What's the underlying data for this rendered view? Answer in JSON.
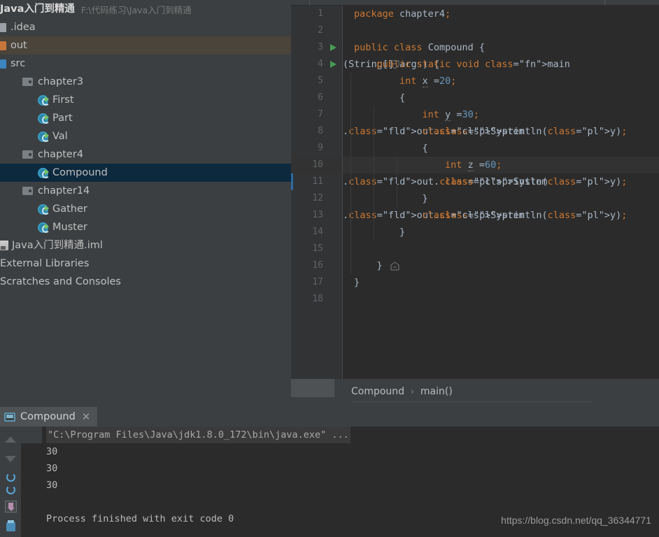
{
  "project": {
    "root": {
      "name": "Java入门到精通",
      "path": "F:\\代码练习\\Java入门到精通",
      "icon": "module-icon"
    },
    "items": [
      {
        "label": ".idea",
        "icon": "module-gray-icon",
        "indent": 0,
        "state": "normal"
      },
      {
        "label": "out",
        "icon": "module-orange-icon",
        "indent": 0,
        "state": "hover"
      },
      {
        "label": "src",
        "icon": "module-blue-icon",
        "indent": 0,
        "state": "normal"
      },
      {
        "label": "chapter3",
        "icon": "folder-icon",
        "indent": 1,
        "state": "normal"
      },
      {
        "label": "First",
        "icon": "java-class-icon",
        "indent": 2,
        "state": "normal"
      },
      {
        "label": "Part",
        "icon": "java-class-icon",
        "indent": 2,
        "state": "normal"
      },
      {
        "label": "Val",
        "icon": "java-class-icon",
        "indent": 2,
        "state": "normal"
      },
      {
        "label": "chapter4",
        "icon": "folder-icon",
        "indent": 1,
        "state": "normal"
      },
      {
        "label": "Compound",
        "icon": "java-class-icon",
        "indent": 2,
        "state": "selected"
      },
      {
        "label": "chapter14",
        "icon": "folder-icon",
        "indent": 1,
        "state": "normal"
      },
      {
        "label": "Gather",
        "icon": "java-class-icon",
        "indent": 2,
        "state": "normal"
      },
      {
        "label": "Muster",
        "icon": "java-class-icon",
        "indent": 2,
        "state": "normal"
      },
      {
        "label": "Java入门到精通.iml",
        "icon": "iml-file-icon",
        "indent": 0,
        "state": "normal"
      },
      {
        "label": "External Libraries",
        "icon": "library-icon",
        "indent": -1,
        "state": "normal"
      },
      {
        "label": "Scratches and Consoles",
        "icon": "scratches-icon",
        "indent": -1,
        "state": "normal"
      }
    ]
  },
  "editor": {
    "caret_line": 10,
    "lines": [
      {
        "n": 1,
        "text": "package chapter4;"
      },
      {
        "n": 2,
        "text": ""
      },
      {
        "n": 3,
        "text": "public class Compound {",
        "run_marker": true
      },
      {
        "n": 4,
        "text": "    public static void main(String[] args) {",
        "run_marker": true,
        "fold": "collapse"
      },
      {
        "n": 5,
        "text": "        int x =20;"
      },
      {
        "n": 6,
        "text": "        {"
      },
      {
        "n": 7,
        "text": "            int y =30;"
      },
      {
        "n": 8,
        "text": "            System.out.println(y);"
      },
      {
        "n": 9,
        "text": "            {"
      },
      {
        "n": 10,
        "text": "                int z =60;"
      },
      {
        "n": 11,
        "text": "                System.out.println(y);"
      },
      {
        "n": 12,
        "text": "            }"
      },
      {
        "n": 13,
        "text": "            System.out.println(y);"
      },
      {
        "n": 14,
        "text": "        }"
      },
      {
        "n": 15,
        "text": ""
      },
      {
        "n": 16,
        "text": "    }",
        "fold": "end"
      },
      {
        "n": 17,
        "text": "}"
      },
      {
        "n": 18,
        "text": ""
      }
    ]
  },
  "breadcrumb": {
    "class": "Compound",
    "separator": "›",
    "method": "main()"
  },
  "run": {
    "tab_label": "Compound",
    "close_label": "✕",
    "toolbar": [
      {
        "icon": "scroll-up-icon"
      },
      {
        "icon": "scroll-down-icon"
      },
      {
        "icon": "rerun-icon"
      },
      {
        "icon": "rerun-failed-icon"
      },
      {
        "icon": "soft-wrap-icon"
      },
      {
        "icon": "print-icon"
      }
    ],
    "console_lines": [
      {
        "text": "\"C:\\Program Files\\Java\\jdk1.8.0_172\\bin\\java.exe\" ...",
        "kind": "command"
      },
      {
        "text": "30",
        "kind": "output"
      },
      {
        "text": "30",
        "kind": "output"
      },
      {
        "text": "30",
        "kind": "output"
      },
      {
        "text": "",
        "kind": "output"
      },
      {
        "text": "Process finished with exit code 0",
        "kind": "output"
      }
    ]
  },
  "watermark": "https://blog.csdn.net/qq_36344771",
  "colors": {
    "editor_bg": "#2b2b2b",
    "panel_bg": "#3c3f41",
    "gutter_bg": "#313335",
    "selection_bg": "#0d293e",
    "hover_bg": "#4a443b",
    "keyword": "#cc7832",
    "number": "#6897bb",
    "field": "#9876aa",
    "method": "#ffc66d",
    "text": "#a9b7c6",
    "run_green": "#499c54"
  }
}
